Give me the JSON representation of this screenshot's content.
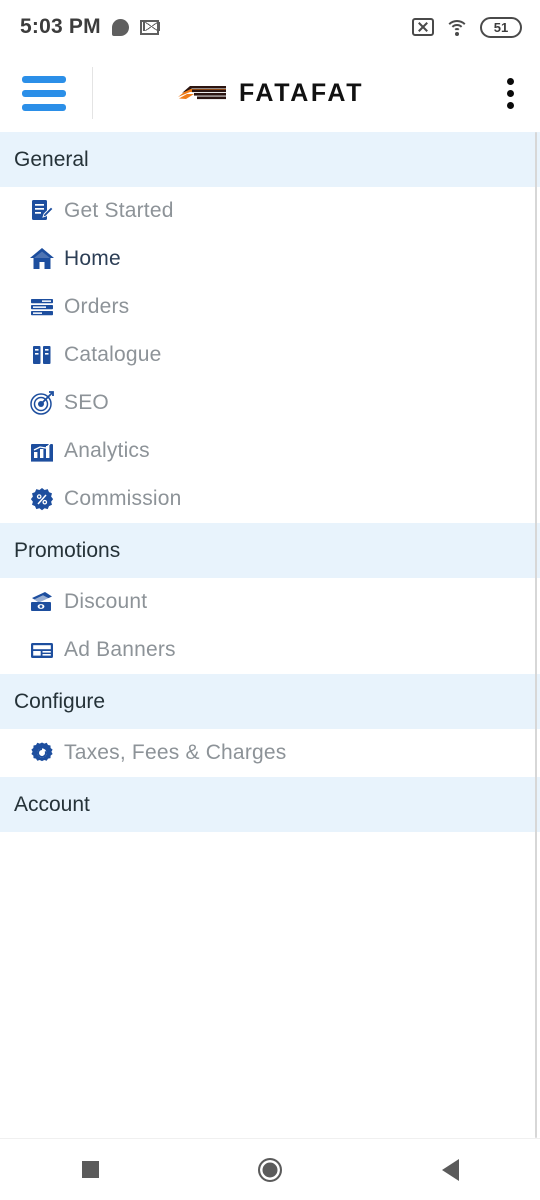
{
  "status_bar": {
    "time": "5:03 PM",
    "battery_level": "51",
    "icons": [
      "chat-bubble-icon",
      "gmail-icon",
      "no-sim-icon",
      "wifi-icon",
      "battery-icon"
    ]
  },
  "app_bar": {
    "menu_icon": "hamburger-menu-icon",
    "brand_mark": "fatafat-logo-mark",
    "brand_name": "FATAFAT",
    "overflow_icon": "kebab-menu-icon"
  },
  "colors": {
    "accent_blue": "#2b8fe8",
    "icon_navy": "#1d4e9e",
    "section_bg": "#e8f3fc",
    "label_inactive": "#8d9398",
    "label_active": "#2c3e55",
    "brand_orange": "#f07c18",
    "brand_dark": "#2a1410"
  },
  "drawer": {
    "sections": [
      {
        "title": "General",
        "items": [
          {
            "label": "Get Started",
            "icon": "document-edit-icon",
            "active": false
          },
          {
            "label": "Home",
            "icon": "home-icon",
            "active": true
          },
          {
            "label": "Orders",
            "icon": "orders-list-icon",
            "active": false
          },
          {
            "label": "Catalogue",
            "icon": "catalogue-icon",
            "active": false
          },
          {
            "label": "SEO",
            "icon": "target-icon",
            "active": false
          },
          {
            "label": "Analytics",
            "icon": "bar-chart-icon",
            "active": false
          },
          {
            "label": "Commission",
            "icon": "percent-badge-icon",
            "active": false
          }
        ]
      },
      {
        "title": "Promotions",
        "items": [
          {
            "label": "Discount",
            "icon": "money-icon",
            "active": false
          },
          {
            "label": "Ad Banners",
            "icon": "ad-banner-icon",
            "active": false
          }
        ]
      },
      {
        "title": "Configure",
        "items": [
          {
            "label": "Taxes, Fees & Charges",
            "icon": "gear-icon",
            "active": false
          }
        ]
      },
      {
        "title": "Account",
        "items": []
      }
    ]
  },
  "navigation_bar": {
    "recents_label": "Recents",
    "home_label": "Home",
    "back_label": "Back"
  }
}
